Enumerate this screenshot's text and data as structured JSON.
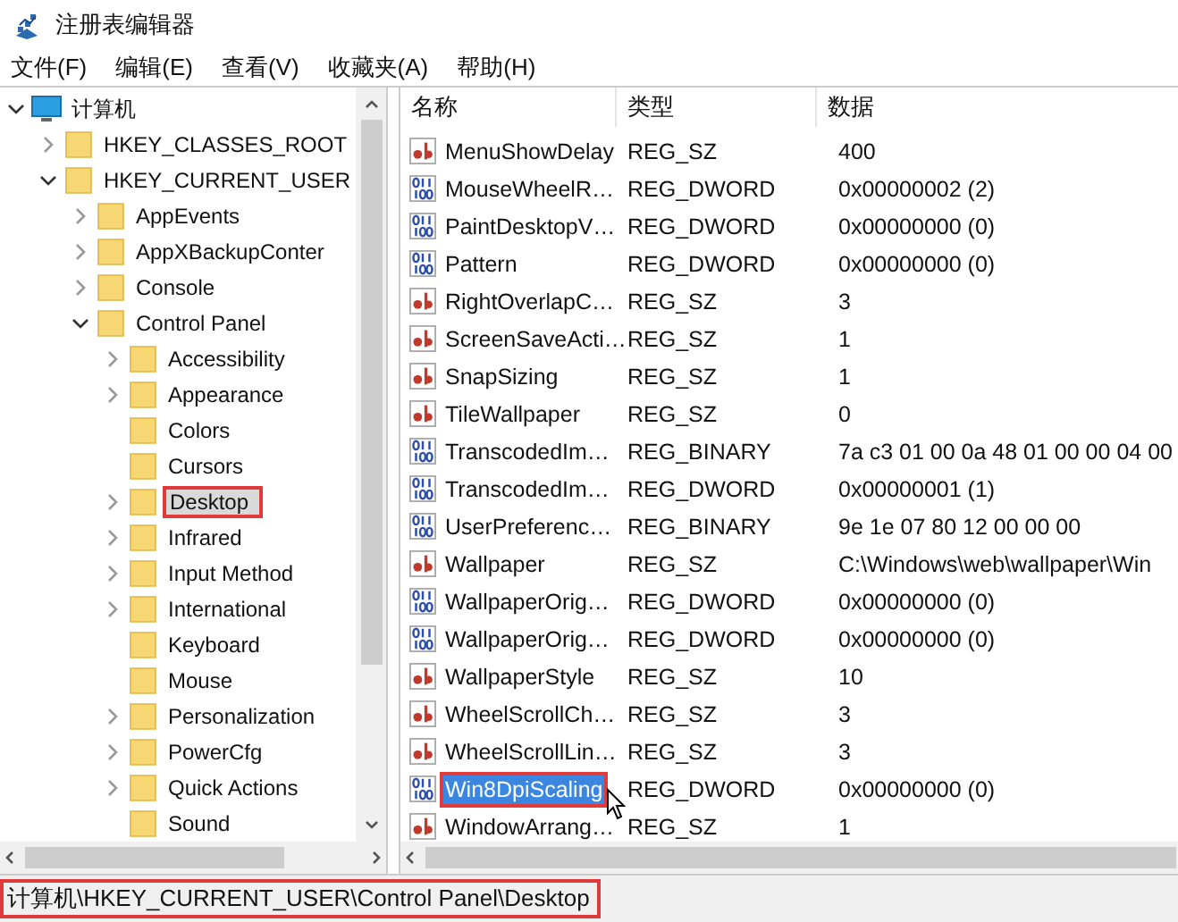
{
  "window": {
    "title": "注册表编辑器"
  },
  "menu": [
    "文件(F)",
    "编辑(E)",
    "查看(V)",
    "收藏夹(A)",
    "帮助(H)"
  ],
  "tree": [
    {
      "label": "计算机",
      "kind": "computer",
      "has_children": true,
      "expanded": true,
      "selected": false,
      "highlighted": false,
      "children": [
        {
          "label": "HKEY_CLASSES_ROOT",
          "kind": "folder",
          "has_children": true,
          "expanded": false,
          "selected": false,
          "highlighted": false
        },
        {
          "label": "HKEY_CURRENT_USER",
          "kind": "folder",
          "has_children": true,
          "expanded": true,
          "selected": false,
          "highlighted": false,
          "children": [
            {
              "label": "AppEvents",
              "kind": "folder",
              "has_children": true,
              "expanded": false,
              "selected": false,
              "highlighted": false
            },
            {
              "label": "AppXBackupConter",
              "kind": "folder",
              "has_children": true,
              "expanded": false,
              "selected": false,
              "highlighted": false
            },
            {
              "label": "Console",
              "kind": "folder",
              "has_children": true,
              "expanded": false,
              "selected": false,
              "highlighted": false
            },
            {
              "label": "Control Panel",
              "kind": "folder",
              "has_children": true,
              "expanded": true,
              "selected": false,
              "highlighted": false,
              "children": [
                {
                  "label": "Accessibility",
                  "kind": "folder",
                  "has_children": true,
                  "expanded": false,
                  "selected": false,
                  "highlighted": false
                },
                {
                  "label": "Appearance",
                  "kind": "folder",
                  "has_children": true,
                  "expanded": false,
                  "selected": false,
                  "highlighted": false
                },
                {
                  "label": "Colors",
                  "kind": "folder",
                  "has_children": false,
                  "expanded": false,
                  "selected": false,
                  "highlighted": false
                },
                {
                  "label": "Cursors",
                  "kind": "folder",
                  "has_children": false,
                  "expanded": false,
                  "selected": false,
                  "highlighted": false
                },
                {
                  "label": "Desktop",
                  "kind": "folder",
                  "has_children": true,
                  "expanded": false,
                  "selected": true,
                  "highlighted": true
                },
                {
                  "label": "Infrared",
                  "kind": "folder",
                  "has_children": true,
                  "expanded": false,
                  "selected": false,
                  "highlighted": false
                },
                {
                  "label": "Input Method",
                  "kind": "folder",
                  "has_children": true,
                  "expanded": false,
                  "selected": false,
                  "highlighted": false
                },
                {
                  "label": "International",
                  "kind": "folder",
                  "has_children": true,
                  "expanded": false,
                  "selected": false,
                  "highlighted": false
                },
                {
                  "label": "Keyboard",
                  "kind": "folder",
                  "has_children": false,
                  "expanded": false,
                  "selected": false,
                  "highlighted": false
                },
                {
                  "label": "Mouse",
                  "kind": "folder",
                  "has_children": false,
                  "expanded": false,
                  "selected": false,
                  "highlighted": false
                },
                {
                  "label": "Personalization",
                  "kind": "folder",
                  "has_children": true,
                  "expanded": false,
                  "selected": false,
                  "highlighted": false
                },
                {
                  "label": "PowerCfg",
                  "kind": "folder",
                  "has_children": true,
                  "expanded": false,
                  "selected": false,
                  "highlighted": false
                },
                {
                  "label": "Quick Actions",
                  "kind": "folder",
                  "has_children": true,
                  "expanded": false,
                  "selected": false,
                  "highlighted": false
                },
                {
                  "label": "Sound",
                  "kind": "folder",
                  "has_children": false,
                  "expanded": false,
                  "selected": false,
                  "highlighted": false
                }
              ]
            }
          ]
        }
      ]
    }
  ],
  "table": {
    "columns": [
      "名称",
      "类型",
      "数据"
    ],
    "rows": [
      {
        "kind": "string",
        "name": "MenuShowDelay",
        "type": "REG_SZ",
        "data": "400",
        "selected": false,
        "highlighted": false
      },
      {
        "kind": "binary",
        "name": "MouseWheelR…",
        "type": "REG_DWORD",
        "data": "0x00000002 (2)",
        "selected": false,
        "highlighted": false
      },
      {
        "kind": "binary",
        "name": "PaintDesktopV…",
        "type": "REG_DWORD",
        "data": "0x00000000 (0)",
        "selected": false,
        "highlighted": false
      },
      {
        "kind": "binary",
        "name": "Pattern",
        "type": "REG_DWORD",
        "data": "0x00000000 (0)",
        "selected": false,
        "highlighted": false
      },
      {
        "kind": "string",
        "name": "RightOverlapC…",
        "type": "REG_SZ",
        "data": "3",
        "selected": false,
        "highlighted": false
      },
      {
        "kind": "string",
        "name": "ScreenSaveActi…",
        "type": "REG_SZ",
        "data": "1",
        "selected": false,
        "highlighted": false
      },
      {
        "kind": "string",
        "name": "SnapSizing",
        "type": "REG_SZ",
        "data": "1",
        "selected": false,
        "highlighted": false
      },
      {
        "kind": "string",
        "name": "TileWallpaper",
        "type": "REG_SZ",
        "data": "0",
        "selected": false,
        "highlighted": false
      },
      {
        "kind": "binary",
        "name": "TranscodedIm…",
        "type": "REG_BINARY",
        "data": "7a c3 01 00 0a 48 01 00 00 04 00",
        "selected": false,
        "highlighted": false
      },
      {
        "kind": "binary",
        "name": "TranscodedIm…",
        "type": "REG_DWORD",
        "data": "0x00000001 (1)",
        "selected": false,
        "highlighted": false
      },
      {
        "kind": "binary",
        "name": "UserPreferenc…",
        "type": "REG_BINARY",
        "data": "9e 1e 07 80 12 00 00 00",
        "selected": false,
        "highlighted": false
      },
      {
        "kind": "string",
        "name": "Wallpaper",
        "type": "REG_SZ",
        "data": "C:\\Windows\\web\\wallpaper\\Win",
        "selected": false,
        "highlighted": false
      },
      {
        "kind": "binary",
        "name": "WallpaperOrig…",
        "type": "REG_DWORD",
        "data": "0x00000000 (0)",
        "selected": false,
        "highlighted": false
      },
      {
        "kind": "binary",
        "name": "WallpaperOrig…",
        "type": "REG_DWORD",
        "data": "0x00000000 (0)",
        "selected": false,
        "highlighted": false
      },
      {
        "kind": "string",
        "name": "WallpaperStyle",
        "type": "REG_SZ",
        "data": "10",
        "selected": false,
        "highlighted": false
      },
      {
        "kind": "string",
        "name": "WheelScrollCh…",
        "type": "REG_SZ",
        "data": "3",
        "selected": false,
        "highlighted": false
      },
      {
        "kind": "string",
        "name": "WheelScrollLin…",
        "type": "REG_SZ",
        "data": "3",
        "selected": false,
        "highlighted": false
      },
      {
        "kind": "binary",
        "name": "Win8DpiScaling",
        "type": "REG_DWORD",
        "data": "0x00000000 (0)",
        "selected": true,
        "highlighted": true
      },
      {
        "kind": "string",
        "name": "WindowArrang…",
        "type": "REG_SZ",
        "data": "1",
        "selected": false,
        "highlighted": false
      }
    ]
  },
  "status_bar": {
    "path": "计算机\\HKEY_CURRENT_USER\\Control Panel\\Desktop",
    "highlighted": true
  }
}
